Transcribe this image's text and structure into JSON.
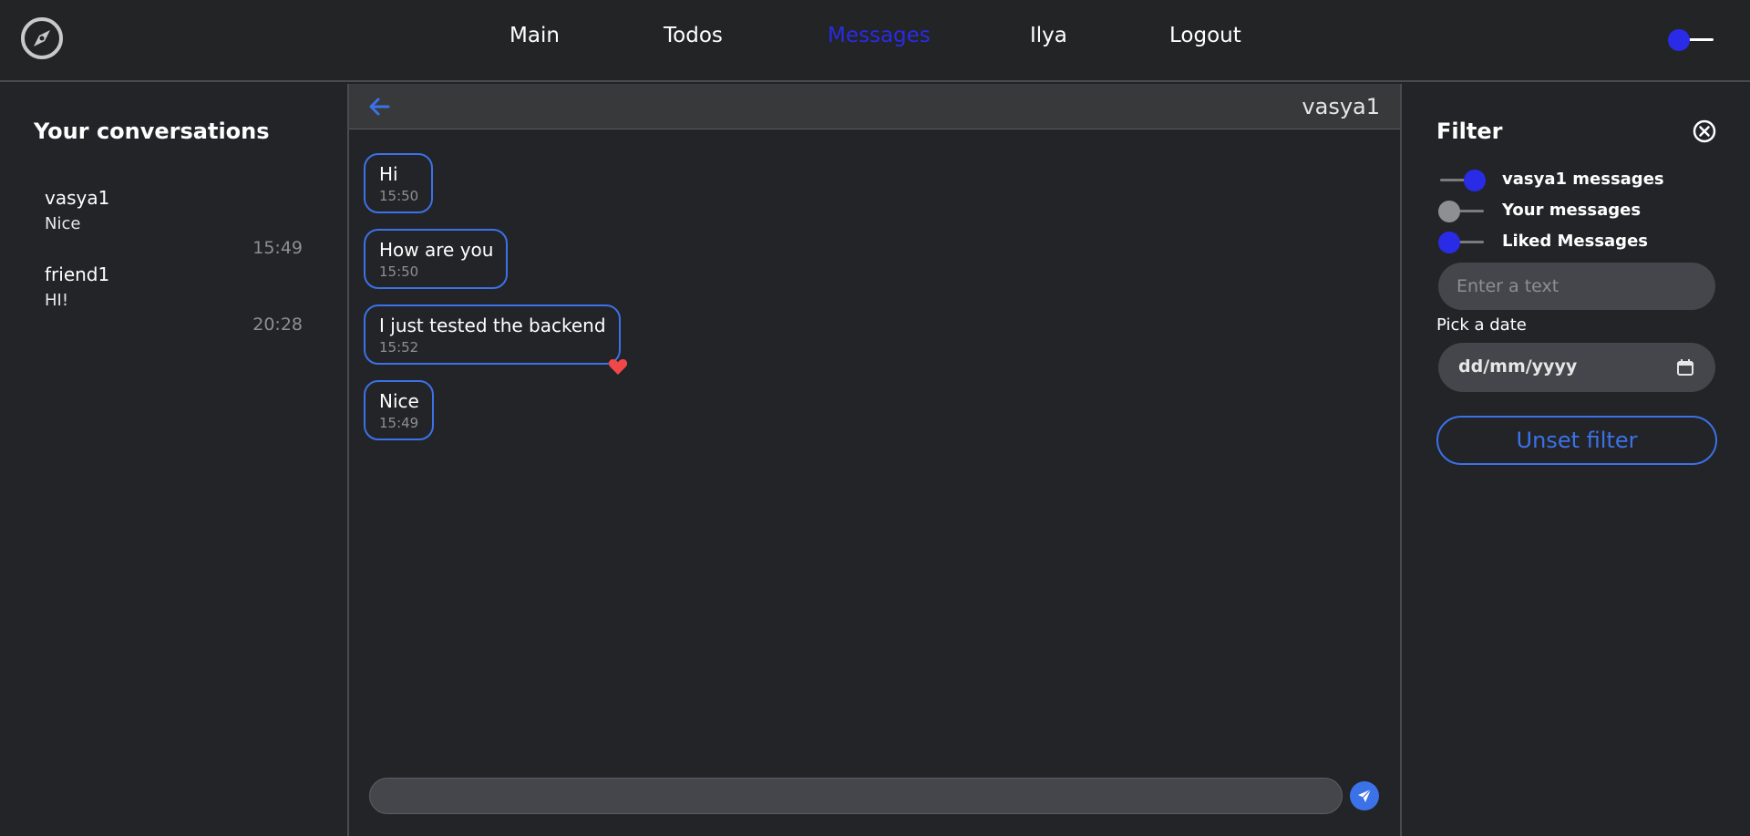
{
  "nav": {
    "items": [
      {
        "label": "Main",
        "active": false
      },
      {
        "label": "Todos",
        "active": false
      },
      {
        "label": "Messages",
        "active": true
      },
      {
        "label": "Ilya",
        "active": false
      },
      {
        "label": "Logout",
        "active": false
      }
    ],
    "theme_toggle": {
      "state": "on"
    }
  },
  "sidebar": {
    "title": "Your conversations",
    "conversations": [
      {
        "name": "vasya1",
        "last_message": "Nice",
        "time": "15:49"
      },
      {
        "name": "friend1",
        "last_message": "HI!",
        "time": "20:28"
      }
    ]
  },
  "chat": {
    "contact": "vasya1",
    "messages": [
      {
        "text": "Hi",
        "time": "15:50",
        "liked": false
      },
      {
        "text": "How are you",
        "time": "15:50",
        "liked": false
      },
      {
        "text": "I just tested the backend",
        "time": "15:52",
        "liked": true
      },
      {
        "text": "Nice",
        "time": "15:49",
        "liked": false
      }
    ],
    "composer": {
      "value": "",
      "placeholder": ""
    }
  },
  "filter": {
    "title": "Filter",
    "toggles": [
      {
        "label": "vasya1 messages",
        "on": true
      },
      {
        "label": "Your messages",
        "on": false
      },
      {
        "label": "Liked Messages",
        "on": false
      }
    ],
    "text_placeholder": "Enter a text",
    "date_label": "Pick a date",
    "date_placeholder": "dd/mm/yyyy",
    "unset_label": "Unset filter"
  },
  "colors": {
    "accent_blue": "#3b72e8",
    "active_nav": "#2a2be6",
    "toggle_knob_on": "#2a2be6",
    "toggle_knob_off": "#8e8f93",
    "heart": "#f04848",
    "background": "#222327"
  },
  "icons": {
    "logo": "compass-icon",
    "back": "arrow-left-icon",
    "send": "paper-plane-icon",
    "close": "close-circle-icon",
    "calendar": "calendar-icon",
    "liked": "heart-icon"
  }
}
